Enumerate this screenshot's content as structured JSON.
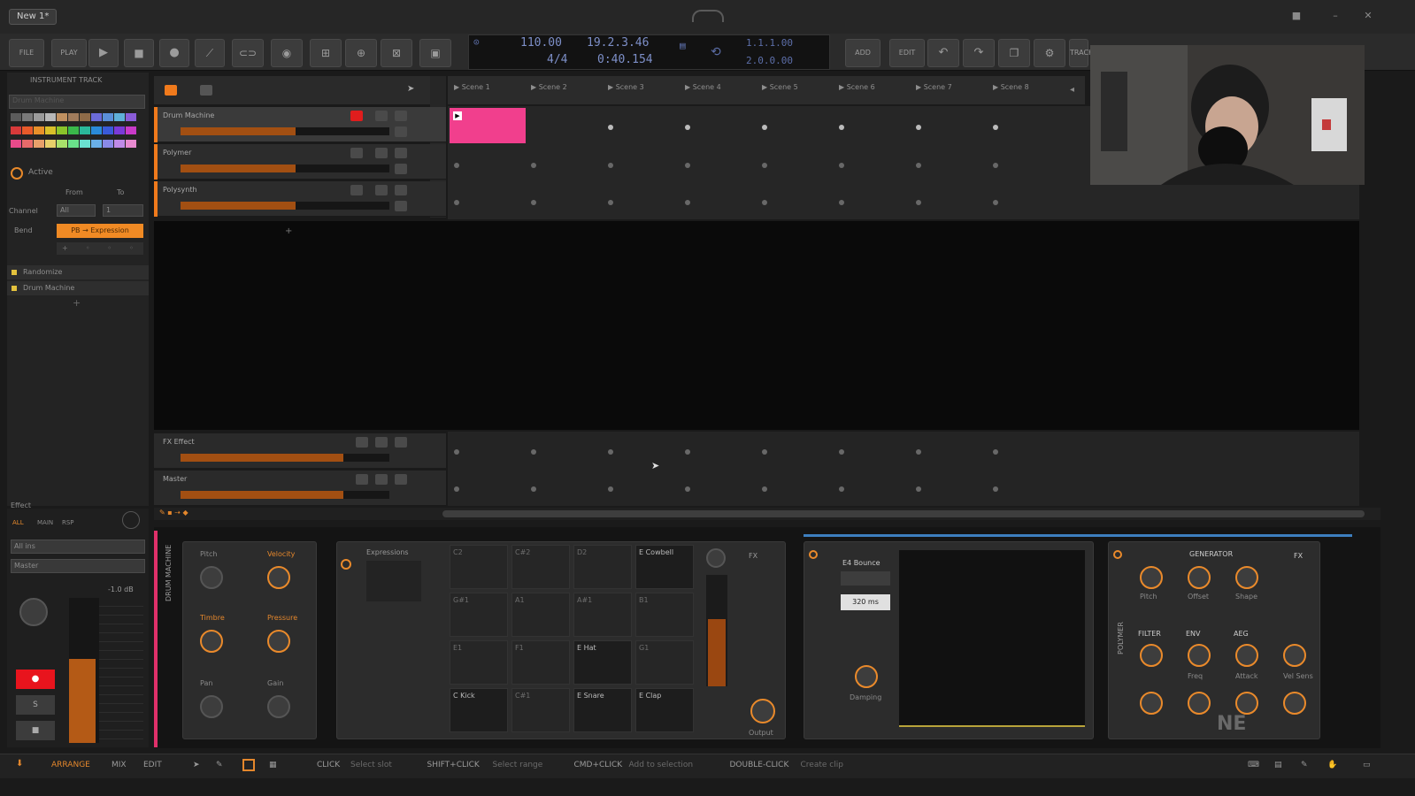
{
  "window": {
    "doc_tab": "New 1*"
  },
  "toolbar": {
    "file": "FILE",
    "play_menu": "PLAY",
    "add": "ADD",
    "edit": "EDIT",
    "mix": "TRACK",
    "tempo": "110.00",
    "time_sig": "4/4",
    "position_bars": "19.2.3.46",
    "position_time": "0:40.154",
    "loop_start": "1.1.1.00",
    "loop_len": "2.0.0.00"
  },
  "inspector": {
    "title": "INSTRUMENT TRACK",
    "track_name": "Drum Machine",
    "active_label": "Active",
    "from_label": "From",
    "to_label": "To",
    "channel_label": "Channel",
    "channel_from": "All",
    "channel_to": "1",
    "bend_label": "Bend",
    "expression_label": "PB → Expression",
    "list": [
      "Randomize",
      "Drum Machine"
    ],
    "effect_label": "Effect",
    "tabs": [
      "ALL",
      "MAIN",
      "RSP"
    ],
    "route_1": "All ins",
    "route_2": "Master",
    "db_value": "-1.0 dB"
  },
  "tracks": [
    {
      "name": "Drum Machine",
      "level": 55
    },
    {
      "name": "Polymer",
      "level": 55
    },
    {
      "name": "Polysynth",
      "level": 55
    }
  ],
  "effect_tracks": [
    {
      "name": "FX Effect",
      "level": 78
    },
    {
      "name": "Master",
      "level": 78
    }
  ],
  "scenes": [
    "Scene 1",
    "Scene 2",
    "Scene 3",
    "Scene 4",
    "Scene 5",
    "Scene 6",
    "Scene 7",
    "Scene 8"
  ],
  "devices": {
    "drum_machine_title": "DRUM MACHINE",
    "knobs_left": [
      "Pitch",
      "Velocity",
      "Timbre",
      "Pressure",
      "Pan",
      "Gain"
    ],
    "expressions_title": "Expressions",
    "pads": [
      "C2",
      "C#2",
      "D2",
      "E Cowbell",
      "G#1",
      "A1",
      "A#1",
      "B1",
      "E1",
      "F1",
      "E Hat",
      "G1",
      "C Kick",
      "C#1",
      "E Snare",
      "E Clap"
    ],
    "mix_label": "FX",
    "output_label": "Output",
    "bounce_title": "E4 Bounce",
    "bounce_value": "320 ms",
    "damping_label": "Damping",
    "polymer_title": "POLYMER",
    "generator_title": "GENERATOR",
    "gen_knobs": [
      "Pitch",
      "Offset",
      "Shape"
    ],
    "filter_labels": [
      "FILTER",
      "ENV",
      "AEG"
    ],
    "filter_knobs": [
      "Freq",
      "Attack",
      "Vel Sens"
    ],
    "fx_label": "FX"
  },
  "statusbar": {
    "tabs": [
      "ARRANGE",
      "MIX",
      "EDIT"
    ],
    "hints": [
      {
        "key": "CLICK",
        "desc": "Select slot"
      },
      {
        "key": "SHIFT+CLICK",
        "desc": "Select range"
      },
      {
        "key": "CMD+CLICK",
        "desc": "Add to selection"
      },
      {
        "key": "DOUBLE-CLICK",
        "desc": "Create clip"
      }
    ]
  },
  "watermark": "NE",
  "colors": {
    "accent": "#f08a24",
    "clip": "#f13f8d",
    "lcd": "#7d8fc8",
    "meter": "#a24f12"
  }
}
